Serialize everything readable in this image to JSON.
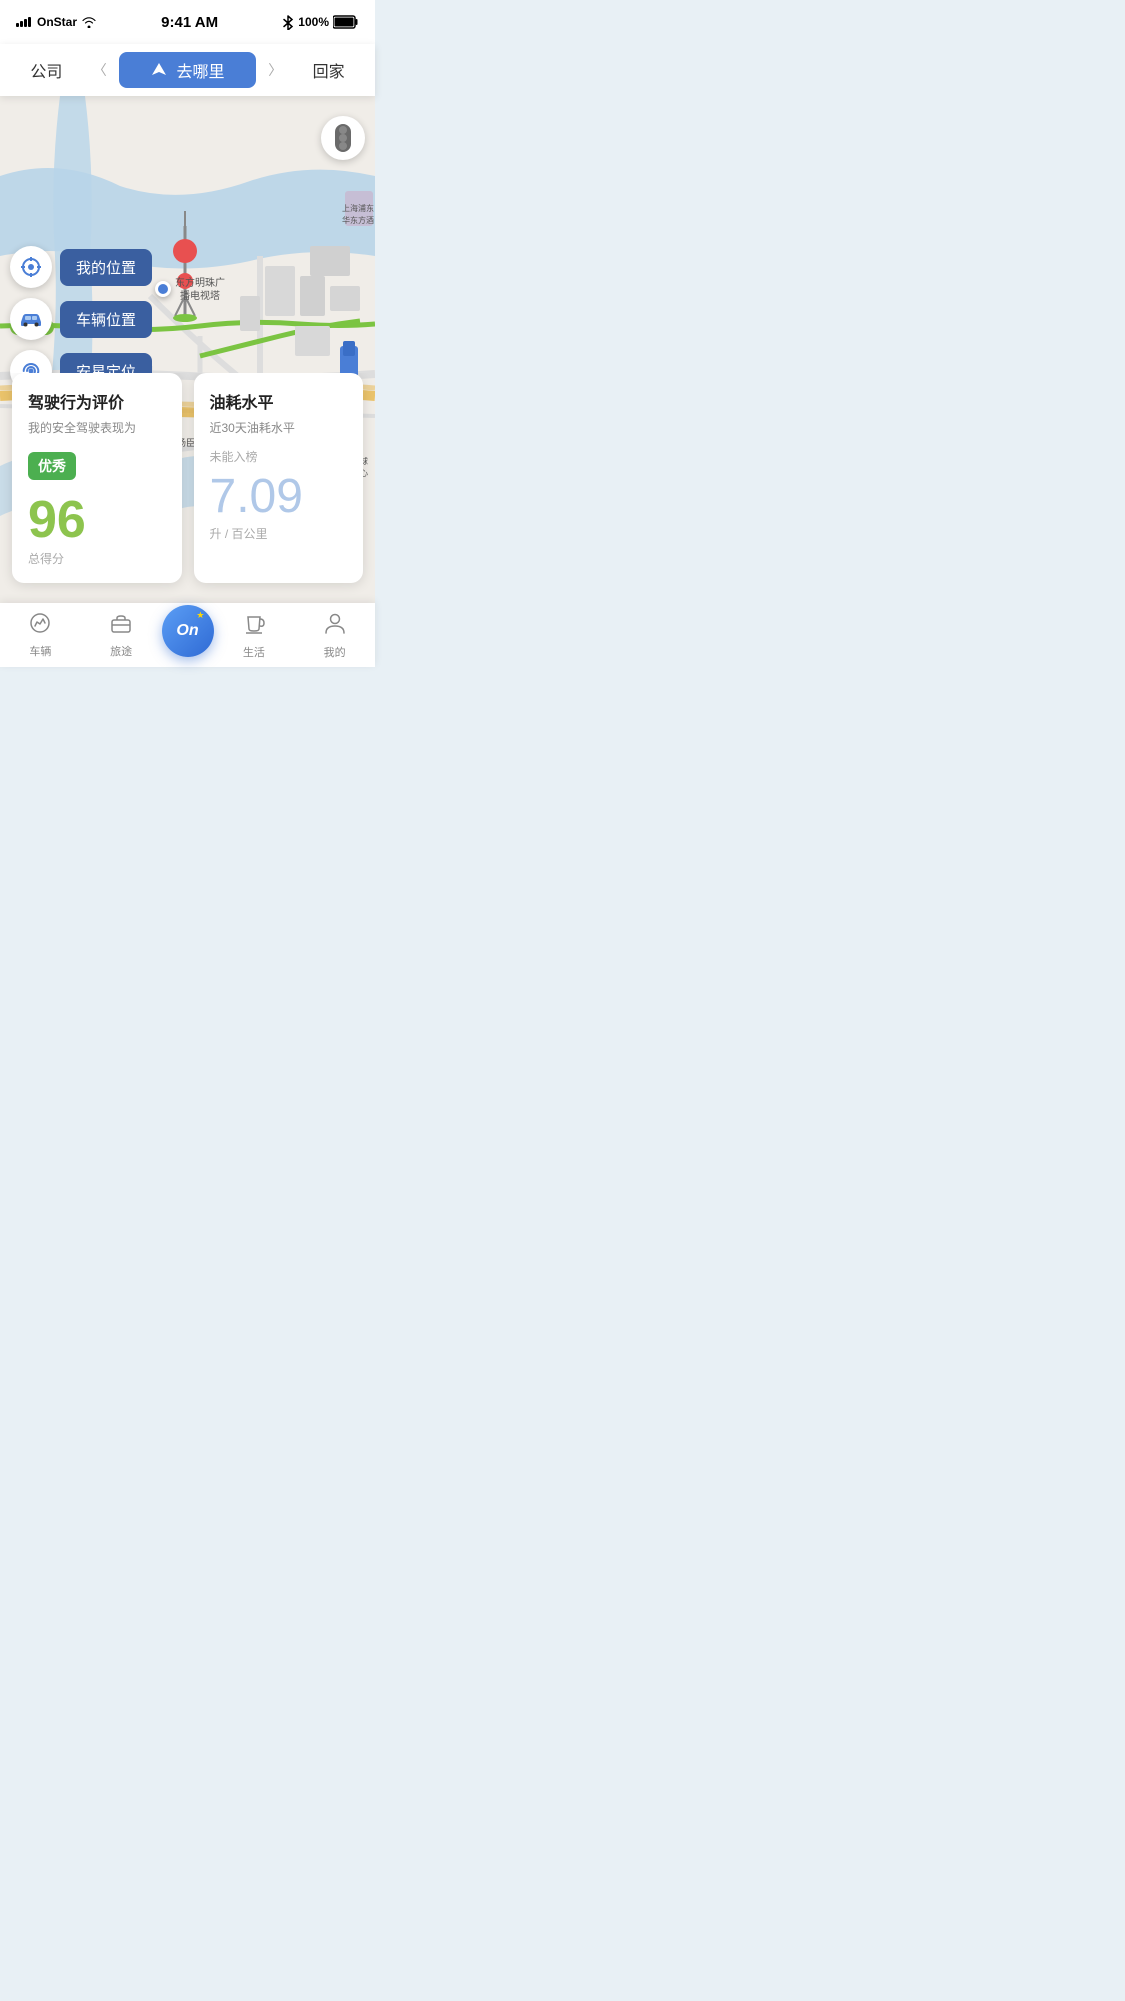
{
  "status_bar": {
    "carrier": "OnStar",
    "time": "9:41 AM",
    "battery": "100%"
  },
  "search_bar": {
    "work_label": "公司",
    "go_where_label": "去哪里",
    "home_label": "回家",
    "chevron_left": "〈",
    "chevron_right": "〉"
  },
  "map": {
    "location_label": "东方明珠广\n播电视塔",
    "landmark1": "汤臣一品",
    "landmark2": "上海环球\n金融中心",
    "landmark3": "上海浦东\n华东方酒店"
  },
  "map_buttons": [
    {
      "id": "my-location",
      "label": "我的位置",
      "icon": "⊙"
    },
    {
      "id": "vehicle-location",
      "label": "车辆位置",
      "icon": "🚗"
    },
    {
      "id": "satellite-positioning",
      "label": "安星定位",
      "icon": "wifi"
    }
  ],
  "cards": [
    {
      "id": "driving-behavior",
      "title": "驾驶行为评价",
      "subtitle": "我的安全驾驶表现为",
      "badge": "优秀",
      "score": "96",
      "score_label": "总得分"
    },
    {
      "id": "fuel-level",
      "title": "油耗水平",
      "subtitle": "近30天油耗水平",
      "rank_text": "未能入榜",
      "fuel_value": "7.09",
      "fuel_unit": "升 / 百公里"
    }
  ],
  "bottom_nav": [
    {
      "id": "vehicle",
      "label": "车辆",
      "icon": "chart",
      "active": false
    },
    {
      "id": "trip",
      "label": "旅途",
      "icon": "bag",
      "active": false
    },
    {
      "id": "home-center",
      "label": "On",
      "icon": "on",
      "active": true,
      "center": true
    },
    {
      "id": "life",
      "label": "生活",
      "icon": "cup",
      "active": false
    },
    {
      "id": "mine",
      "label": "我的",
      "icon": "person",
      "active": false
    }
  ]
}
